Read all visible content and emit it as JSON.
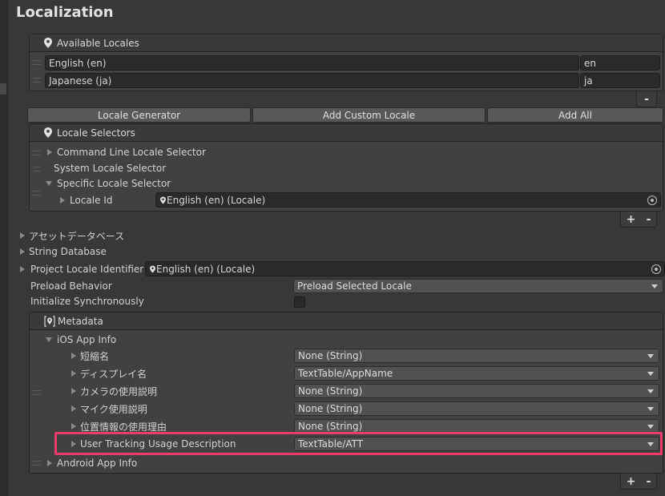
{
  "window": {
    "title": "Localization"
  },
  "available_locales": {
    "header": "Available Locales",
    "items": [
      {
        "name": "English (en)",
        "code": "en"
      },
      {
        "name": "Japanese (ja)",
        "code": "ja"
      }
    ],
    "remove_label": "-"
  },
  "locale_buttons": {
    "generator": "Locale Generator",
    "add_custom": "Add Custom Locale",
    "add_all": "Add All"
  },
  "locale_selectors": {
    "header": "Locale Selectors",
    "items": [
      "Command Line Locale Selector",
      "System Locale Selector",
      "Specific Locale Selector"
    ],
    "locale_id_label": "Locale Id",
    "locale_id_value": "English (en) (Locale)",
    "add_label": "+",
    "remove_label": "-"
  },
  "settings": {
    "asset_database": "アセットデータベース",
    "string_database": "String Database",
    "project_locale_label": "Project Locale Identifier",
    "project_locale_value": "English (en) (Locale)",
    "preload_label": "Preload Behavior",
    "preload_value": "Preload Selected Locale",
    "init_sync_label": "Initialize Synchronously",
    "init_sync_checked": false
  },
  "metadata": {
    "header": "Metadata",
    "ios_label": "iOS App Info",
    "ios_rows": [
      {
        "label": "短縮名",
        "value": "None (String)"
      },
      {
        "label": "ディスプレイ名",
        "value": "TextTable/AppName"
      },
      {
        "label": "カメラの使用説明",
        "value": "None (String)"
      },
      {
        "label": "マイク使用説明",
        "value": "None (String)"
      },
      {
        "label": "位置情報の使用理由",
        "value": "None (String)"
      },
      {
        "label": "User Tracking Usage Description",
        "value": "TextTable/ATT"
      }
    ],
    "android_label": "Android App Info",
    "add_label": "+",
    "remove_label": "-"
  },
  "colors": {
    "background": "#383838",
    "highlight": "#f03a6e"
  }
}
